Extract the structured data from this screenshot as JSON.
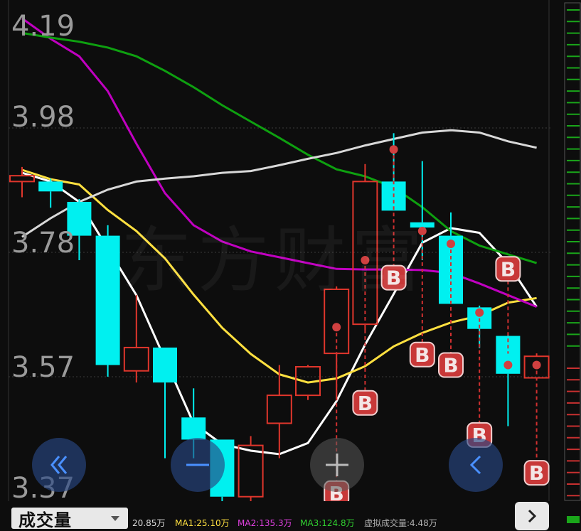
{
  "colors": {
    "background": "#0d0d0d",
    "up_candle": "#e0362c",
    "down_candle": "#00f0f0",
    "ma_white": "#ffffff",
    "ma_yellow": "#ffe040",
    "ma_magenta": "#c000c0",
    "ma_green": "#0ea010",
    "ma_lightgray": "#d8d8d8",
    "b_badge": "#e0362c",
    "grid": "#3a3a3a"
  },
  "price_axis": {
    "labels": [
      "4.19",
      "3.98",
      "3.78",
      "3.57",
      "3.37"
    ],
    "max": 4.19,
    "min": 3.37
  },
  "watermark": "东方财富",
  "buy_marker_label": "B",
  "candles": [
    {
      "o": 3.915,
      "c": 3.925,
      "h": 3.94,
      "l": 3.888,
      "type": "up"
    },
    {
      "o": 3.915,
      "c": 3.898,
      "h": 3.92,
      "l": 3.87,
      "type": "down"
    },
    {
      "o": 3.88,
      "c": 3.822,
      "h": 3.885,
      "l": 3.78,
      "type": "down"
    },
    {
      "o": 3.822,
      "c": 3.6,
      "h": 3.84,
      "l": 3.58,
      "type": "down"
    },
    {
      "o": 3.59,
      "c": 3.63,
      "h": 3.72,
      "l": 3.57,
      "type": "up"
    },
    {
      "o": 3.63,
      "c": 3.57,
      "h": 3.63,
      "l": 3.44,
      "type": "down"
    },
    {
      "o": 3.51,
      "c": 3.472,
      "h": 3.56,
      "l": 3.44,
      "type": "down"
    },
    {
      "o": 3.472,
      "c": 3.374,
      "h": 3.472,
      "l": 3.365,
      "type": "down"
    },
    {
      "o": 3.374,
      "c": 3.462,
      "h": 3.478,
      "l": 3.36,
      "type": "up"
    },
    {
      "o": 3.5,
      "c": 3.548,
      "h": 3.6,
      "l": 3.44,
      "type": "up"
    },
    {
      "o": 3.548,
      "c": 3.597,
      "h": 3.6,
      "l": 3.54,
      "type": "up"
    },
    {
      "o": 3.62,
      "c": 3.73,
      "h": 3.735,
      "l": 3.54,
      "type": "up"
    },
    {
      "o": 3.67,
      "c": 3.915,
      "h": 3.945,
      "l": 3.66,
      "type": "up"
    },
    {
      "o": 3.915,
      "c": 3.865,
      "h": 3.998,
      "l": 3.865,
      "type": "down"
    },
    {
      "o": 3.845,
      "c": 3.836,
      "h": 3.95,
      "l": 3.78,
      "type": "down"
    },
    {
      "o": 3.822,
      "c": 3.705,
      "h": 3.862,
      "l": 3.705,
      "type": "down"
    },
    {
      "o": 3.699,
      "c": 3.662,
      "h": 3.702,
      "l": 3.629,
      "type": "down"
    },
    {
      "o": 3.65,
      "c": 3.585,
      "h": 3.651,
      "l": 3.495,
      "type": "down"
    },
    {
      "o": 3.578,
      "c": 3.615,
      "h": 3.62,
      "l": 3.576,
      "type": "up"
    }
  ],
  "buy_signals": [
    {
      "candle": 11,
      "price": 3.665,
      "badge_price": 3.38
    },
    {
      "candle": 12,
      "price": 3.78,
      "badge_price": 3.535
    },
    {
      "candle": 13,
      "price": 3.97,
      "badge_price": 3.75
    },
    {
      "candle": 14,
      "price": 3.83,
      "badge_price": 3.618
    },
    {
      "candle": 15,
      "price": 3.808,
      "badge_price": 3.6
    },
    {
      "candle": 16,
      "price": 3.69,
      "badge_price": 3.48
    },
    {
      "candle": 17,
      "price": 3.6,
      "badge_price": 3.765
    },
    {
      "candle": 18,
      "price": 3.6,
      "badge_price": 3.415
    }
  ],
  "moving_averages": [
    {
      "name": "MA_white",
      "color": "#ffffff",
      "values": [
        3.93,
        3.915,
        3.88,
        3.8,
        3.72,
        3.61,
        3.5,
        3.464,
        3.453,
        3.447,
        3.466,
        3.538,
        3.635,
        3.722,
        3.81,
        3.835,
        3.827,
        3.774,
        3.7
      ]
    },
    {
      "name": "MA_yellow",
      "color": "#ffe040",
      "values": [
        3.935,
        3.919,
        3.91,
        3.866,
        3.83,
        3.783,
        3.721,
        3.664,
        3.619,
        3.584,
        3.57,
        3.577,
        3.598,
        3.632,
        3.655,
        3.673,
        3.685,
        3.707,
        3.715
      ]
    },
    {
      "name": "MA_magenta",
      "color": "#c000c0",
      "values": [
        4.195,
        4.16,
        4.13,
        4.07,
        3.98,
        3.895,
        3.84,
        3.812,
        3.795,
        3.785,
        3.775,
        3.765,
        3.764,
        3.764,
        3.763,
        3.758,
        3.74,
        3.72,
        3.7
      ]
    },
    {
      "name": "MA_green",
      "color": "#0ea010",
      "values": [
        4.17,
        4.162,
        4.155,
        4.145,
        4.13,
        4.105,
        4.077,
        4.046,
        4.018,
        3.99,
        3.961,
        3.936,
        3.924,
        3.905,
        3.871,
        3.83,
        3.805,
        3.79,
        3.775
      ]
    },
    {
      "name": "MA_lightgray",
      "color": "#d8d8d8",
      "values": [
        3.82,
        3.852,
        3.88,
        3.901,
        3.915,
        3.92,
        3.924,
        3.93,
        3.933,
        3.943,
        3.954,
        3.964,
        3.977,
        3.988,
        3.999,
        4.003,
        3.999,
        3.984,
        3.973
      ]
    }
  ],
  "bottom_bar": {
    "volume_label": "成交量",
    "legend": [
      {
        "text": "20.85万",
        "color": "#dcdcdc"
      },
      {
        "text": "MA1:25.10万",
        "color": "#ffe040"
      },
      {
        "text": "MA2:135.3万",
        "color": "#e040e0"
      },
      {
        "text": "MA3:124.8万",
        "color": "#30d030"
      },
      {
        "text": "虚拟成交量:4.48万",
        "color": "#b0b0b0"
      }
    ]
  },
  "nav_buttons": [
    {
      "name": "fast-backward-button",
      "icon": "double-chevron-left-icon"
    },
    {
      "name": "zoom-out-button",
      "icon": "minus-icon"
    },
    {
      "name": "zoom-in-button",
      "icon": "plus-icon"
    },
    {
      "name": "back-button",
      "icon": "chevron-left-icon"
    }
  ],
  "expand_icon": "chevron-right-icon",
  "depth_panel": {
    "sell_levels": 30,
    "buy_levels": 30
  }
}
